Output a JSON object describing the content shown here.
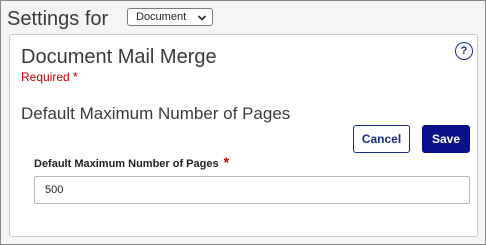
{
  "header": {
    "title": "Settings for",
    "scope_select": {
      "selected": "Document",
      "icon": "chevron-down-icon"
    }
  },
  "panel": {
    "title": "Document Mail Merge",
    "required_note": "Required",
    "required_star": "*",
    "help_label": "?",
    "section_title": "Default Maximum Number of Pages",
    "cancel_label": "Cancel",
    "save_label": "Save",
    "field": {
      "label": "Default Maximum Number of Pages",
      "required_star": "*",
      "value": "500"
    }
  },
  "colors": {
    "primary": "#0a0f8a",
    "required": "#c00000",
    "text": "#3a3a3a"
  }
}
